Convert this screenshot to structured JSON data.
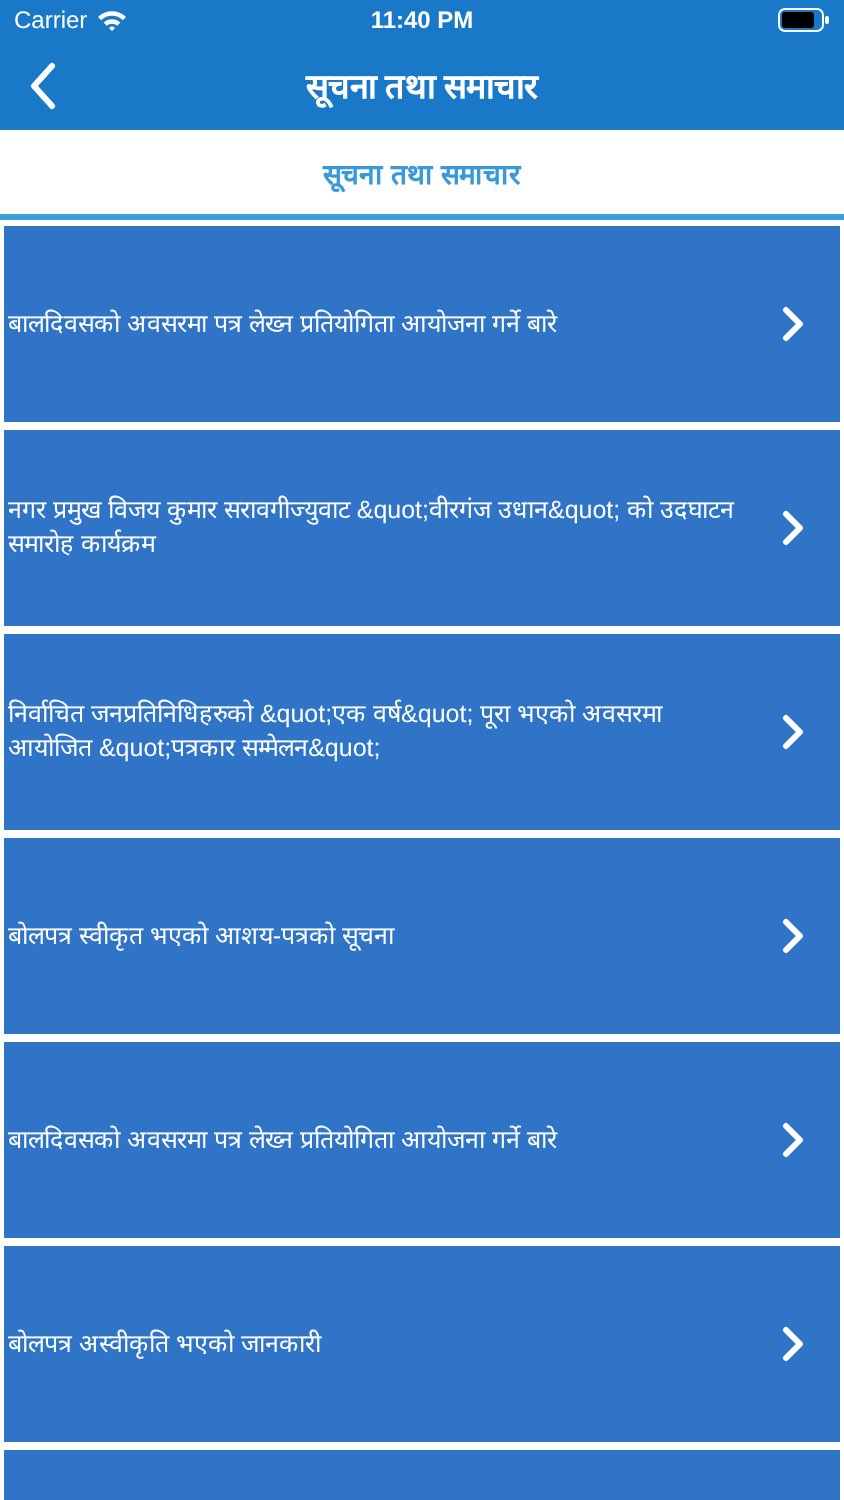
{
  "status_bar": {
    "carrier": "Carrier",
    "time": "11:40 PM"
  },
  "nav_bar": {
    "title": "सूचना तथा समाचार",
    "back": true
  },
  "section_header": {
    "title": "सूचना तथा समाचार"
  },
  "items": [
    {
      "title": "बालदिवसको अवसरमा पत्र लेख्न प्रतियोगिता आयोजना गर्ने बारे"
    },
    {
      "title": "नगर प्रमुख विजय कुमार सरावगीज्युवाट &quot;वीरगंज उधान&quot; को उदघाटन समारोह कार्यक्रम"
    },
    {
      "title": "निर्वाचित जनप्रतिनिधिहरुको &quot;एक वर्ष&quot; पूरा भएको अवसरमा आयोजित &quot;पत्रकार सम्मेलन&quot;"
    },
    {
      "title": "बोलपत्र स्वीकृत भएको आशय-पत्रको सूचना"
    },
    {
      "title": "बालदिवसको अवसरमा पत्र लेख्न प्रतियोगिता आयोजना गर्ने बारे"
    },
    {
      "title": "बोलपत्र अस्वीकृति भएको जानकारी"
    }
  ],
  "more_below": true
}
